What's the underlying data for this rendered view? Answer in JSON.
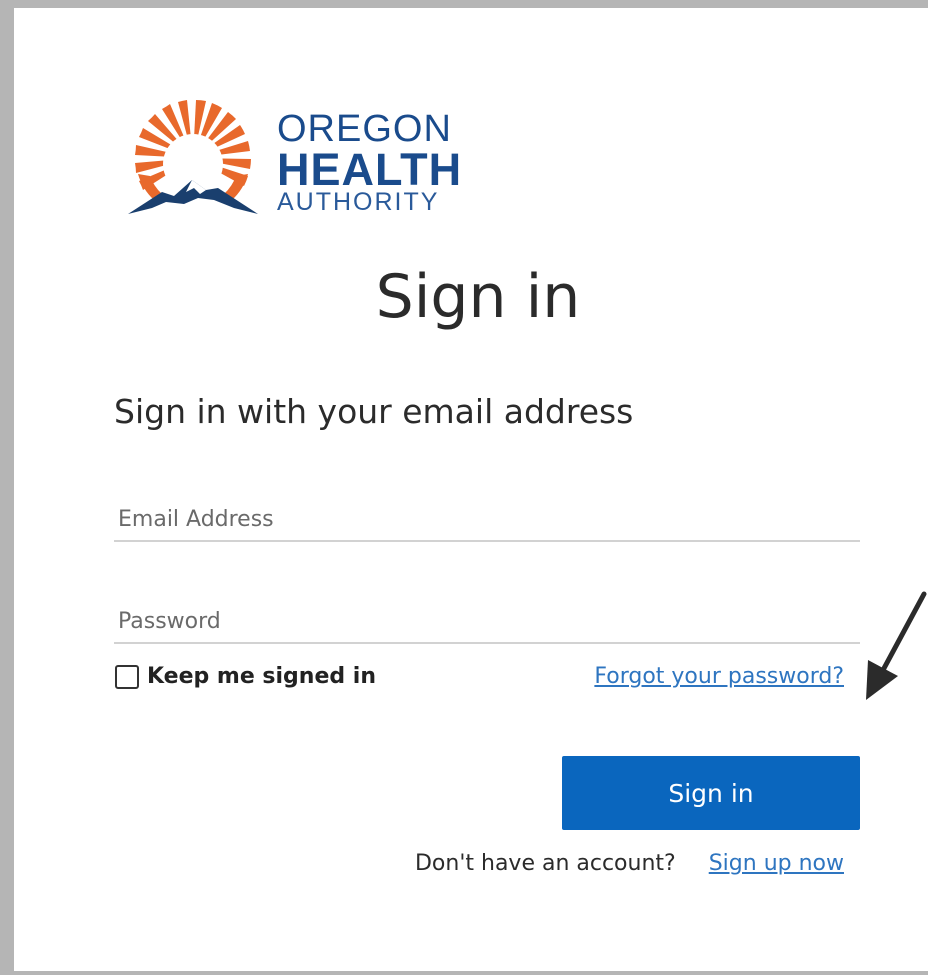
{
  "logo": {
    "line1": "OREGON",
    "line2": "HEALTH",
    "line3": "AUTHORITY",
    "icon": "sun-mountain-logo-icon"
  },
  "title": "Sign in",
  "subtitle": "Sign in with your email address",
  "email": {
    "placeholder": "Email Address",
    "value": ""
  },
  "password": {
    "placeholder": "Password",
    "value": ""
  },
  "keep_signed_in": {
    "label": "Keep me signed in",
    "checked": false
  },
  "forgot_password": "Forgot your password?",
  "submit_label": "Sign in",
  "signup": {
    "prompt": "Don't have an account?",
    "link": "Sign up now"
  },
  "annotation": {
    "icon": "arrow-pointer-icon"
  },
  "colors": {
    "primary_button": "#0a66be",
    "link": "#2e75c0",
    "logo_blue": "#1a4b8c",
    "logo_orange": "#e8692c"
  }
}
